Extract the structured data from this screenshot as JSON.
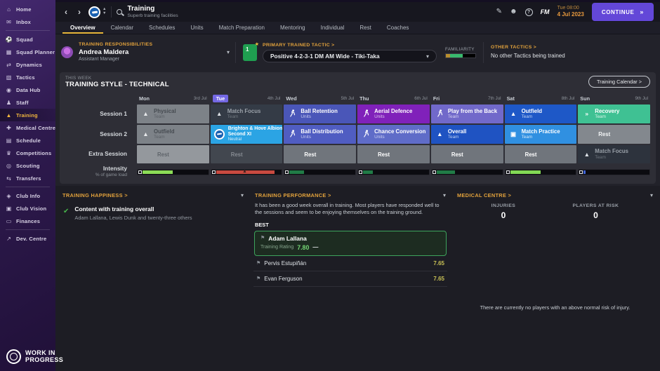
{
  "chrome": {
    "back": "‹",
    "forward": "›",
    "datetime": {
      "line1": "Tue 08:00",
      "line2": "4 Jul 2023"
    },
    "continue_label": "CONTINUE",
    "continue_arrows": "»",
    "fm_logo": "FM",
    "help_glyph": "?",
    "edit_glyph": "✎",
    "face_glyph": "☻"
  },
  "sidebar": {
    "active_index": 8,
    "items": [
      {
        "label": "Home",
        "icon": "home-icon",
        "glyph": "⌂"
      },
      {
        "label": "Inbox",
        "icon": "inbox-icon",
        "glyph": "✉",
        "divider_after": true
      },
      {
        "label": "Squad",
        "icon": "squad-icon",
        "glyph": "⚽"
      },
      {
        "label": "Squad Planner",
        "icon": "squad-planner-icon",
        "glyph": "▦"
      },
      {
        "label": "Dynamics",
        "icon": "dynamics-icon",
        "glyph": "⇄"
      },
      {
        "label": "Tactics",
        "icon": "tactics-icon",
        "glyph": "▧"
      },
      {
        "label": "Data Hub",
        "icon": "data-hub-icon",
        "glyph": "◉"
      },
      {
        "label": "Staff",
        "icon": "staff-icon",
        "glyph": "♟"
      },
      {
        "label": "Training",
        "icon": "training-icon",
        "glyph": "▲"
      },
      {
        "label": "Medical Centre",
        "icon": "medical-icon",
        "glyph": "✚"
      },
      {
        "label": "Schedule",
        "icon": "schedule-icon",
        "glyph": "▤"
      },
      {
        "label": "Competitions",
        "icon": "competitions-icon",
        "glyph": "♛"
      },
      {
        "label": "Scouting",
        "icon": "scouting-icon",
        "glyph": "◎"
      },
      {
        "label": "Transfers",
        "icon": "transfers-icon",
        "glyph": "⇆",
        "divider_after": true
      },
      {
        "label": "Club Info",
        "icon": "club-info-icon",
        "glyph": "◈"
      },
      {
        "label": "Club Vision",
        "icon": "club-vision-icon",
        "glyph": "▣"
      },
      {
        "label": "Finances",
        "icon": "finances-icon",
        "glyph": "▭",
        "divider_after": true
      },
      {
        "label": "Dev. Centre",
        "icon": "dev-centre-icon",
        "glyph": "↗"
      }
    ],
    "footer": {
      "line1": "WORK IN",
      "line2": "PROGRESS"
    }
  },
  "header": {
    "title": "Training",
    "subtitle": "Superb training facilities"
  },
  "tabs": {
    "active_index": 0,
    "items": [
      "Overview",
      "Calendar",
      "Schedules",
      "Units",
      "Match Preparation",
      "Mentoring",
      "Individual",
      "Rest",
      "Coaches"
    ]
  },
  "responsibilities": {
    "heading": "TRAINING RESPONSIBILITIES",
    "name": "Andrea Maldera",
    "role": "Assistant Manager"
  },
  "tactic": {
    "heading": "PRIMARY TRAINED TACTIC >",
    "value": "Positive 4-2-3-1 DM AM Wide - Tiki-Taka",
    "familiarity_label": "FAMILIARITY"
  },
  "other_tactics": {
    "heading": "OTHER TACTICS >",
    "text": "No other Tactics being trained"
  },
  "week": {
    "this_week_label": "THIS WEEK",
    "title": "TRAINING STYLE - TECHNICAL",
    "calendar_button": "Training Calendar >",
    "row_labels": {
      "session1": "Session 1",
      "session2": "Session 2",
      "extra": "Extra Session",
      "intensity": "Intensity",
      "intensity_sub": "% of game load"
    },
    "days": [
      {
        "name": "Mon",
        "date": "3rd Jul",
        "today": false,
        "session1": {
          "title": "Physical",
          "subtitle": "Team",
          "icon": "cone",
          "bg": "#7d8288",
          "fg": "#464b51",
          "sub": "#5a5f65",
          "ic": "#e6e8ea"
        },
        "session2": {
          "title": "Outfield",
          "subtitle": "Team",
          "icon": "cone",
          "bg": "#7d8288",
          "fg": "#464b51",
          "sub": "#5a5f65",
          "ic": "#e6e8ea"
        },
        "extra": {
          "type": "rest",
          "title": "Rest",
          "bg": "#94989d",
          "fg": "#5f646a"
        },
        "intensity": {
          "pct": 44,
          "color": "#8cdc57"
        }
      },
      {
        "name": "Tue",
        "date": "4th Jul",
        "today": true,
        "session1": {
          "title": "Match Focus",
          "subtitle": "Team",
          "icon": "cone",
          "bg": "#343b46",
          "fg": "#9aa1a9",
          "sub": "#717880",
          "ic": "#dde1e6"
        },
        "session2": {
          "type": "match",
          "title": "Brighton & Hove Albion",
          "title2": "Second XI",
          "subtitle": "Neutral",
          "bg": "#2ba4e4"
        },
        "extra": {
          "type": "rest",
          "title": "Rest",
          "bg": "#42474f",
          "fg": "#868b92"
        },
        "intensity": {
          "pct": 84,
          "color": "#c84a40",
          "warning": true
        }
      },
      {
        "name": "Wed",
        "date": "5th Jul",
        "today": false,
        "session1": {
          "title": "Ball Retention",
          "subtitle": "Units",
          "icon": "player",
          "bg": "#4a56b8",
          "fg": "#ffffff",
          "sub": "#c7ccf0",
          "ic": "#ffffff"
        },
        "session2": {
          "title": "Ball Distribution",
          "subtitle": "Units",
          "icon": "player",
          "bg": "#505dc2",
          "fg": "#ffffff",
          "sub": "#c7ccf0",
          "ic": "#ffffff"
        },
        "extra": {
          "type": "rest",
          "title": "Rest",
          "bg": "#70757c",
          "fg": "#ffffff"
        },
        "intensity": {
          "pct": 21,
          "color": "#217b46"
        }
      },
      {
        "name": "Thu",
        "date": "6th Jul",
        "today": false,
        "session1": {
          "title": "Aerial Defence",
          "subtitle": "Units",
          "icon": "player",
          "bg": "#8021ba",
          "fg": "#ffffff",
          "sub": "#dcc4ee",
          "ic": "#ffffff"
        },
        "session2": {
          "title": "Chance Conversion",
          "subtitle": "Units",
          "icon": "player",
          "bg": "#5f6cc8",
          "fg": "#ffffff",
          "sub": "#ccd1f2",
          "ic": "#ffffff"
        },
        "extra": {
          "type": "rest",
          "title": "Rest",
          "bg": "#70757c",
          "fg": "#ffffff"
        },
        "intensity": {
          "pct": 14,
          "color": "#217b46"
        }
      },
      {
        "name": "Fri",
        "date": "7th Jul",
        "today": false,
        "session1": {
          "title": "Play from the Back",
          "subtitle": "Team",
          "icon": "player",
          "bg": "#7169ca",
          "fg": "#ffffff",
          "sub": "#d4d0f0",
          "ic": "#ffffff"
        },
        "session2": {
          "title": "Overall",
          "subtitle": "Team",
          "icon": "cone",
          "bg": "#1f53c2",
          "fg": "#ffffff",
          "sub": "#bcd0f2",
          "ic": "#ffffff"
        },
        "extra": {
          "type": "rest",
          "title": "Rest",
          "bg": "#70757c",
          "fg": "#ffffff"
        },
        "intensity": {
          "pct": 27,
          "color": "#217b46"
        }
      },
      {
        "name": "Sat",
        "date": "8th Jul",
        "today": false,
        "session1": {
          "title": "Outfield",
          "subtitle": "Team",
          "icon": "cone",
          "bg": "#1e58c7",
          "fg": "#ffffff",
          "sub": "#bcd0f2",
          "ic": "#ffffff"
        },
        "session2": {
          "title": "Match Practice",
          "subtitle": "Team",
          "icon": "goal",
          "bg": "#3090e1",
          "fg": "#ffffff",
          "sub": "#d4e8f9",
          "ic": "#ffffff"
        },
        "extra": {
          "type": "rest",
          "title": "Rest",
          "bg": "#70757c",
          "fg": "#ffffff"
        },
        "intensity": {
          "pct": 44,
          "color": "#82d955"
        }
      },
      {
        "name": "Sun",
        "date": "9th Jul",
        "today": false,
        "session1": {
          "title": "Recovery",
          "subtitle": "Team",
          "icon": "recovery",
          "bg": "#3fc193",
          "fg": "#ffffff",
          "sub": "#dcf5ea",
          "ic": "#ffffff"
        },
        "session2": {
          "type": "rest",
          "title": "Rest",
          "bg": "#83888e",
          "fg": "#f2f4f5"
        },
        "extra": {
          "title": "Match Focus",
          "subtitle": "Team",
          "icon": "cone",
          "bg": "#2d333d",
          "fg": "#99a0a8",
          "sub": "#6d747d",
          "ic": "#dfe3e8"
        },
        "intensity": {
          "pct": 3,
          "color": "#3f64d4"
        }
      }
    ]
  },
  "happiness": {
    "heading": "TRAINING HAPPINESS >",
    "item": {
      "title": "Content with training overall",
      "subtitle": "Adam Lallana, Lewis Dunk and twenty-three others"
    }
  },
  "performance": {
    "heading": "TRAINING PERFORMANCE >",
    "summary": "It has been a good week overall in training. Most players have responded well to the sessions and seem to be enjoying themselves on the training ground.",
    "best_label": "BEST",
    "best": {
      "name": "Adam Lallana",
      "rating_label": "Training Rating",
      "rating": "7.80",
      "trend": "—"
    },
    "others": [
      {
        "name": "Pervis Estupiñán",
        "rating": "7.65"
      },
      {
        "name": "Evan Ferguson",
        "rating": "7.65"
      }
    ]
  },
  "medical": {
    "heading": "MEDICAL CENTRE >",
    "stats": [
      {
        "label": "INJURIES",
        "value": "0"
      },
      {
        "label": "PLAYERS AT RISK",
        "value": "0"
      }
    ],
    "note": "There are currently no players with an above normal risk of injury."
  },
  "colors": {
    "accent_orange": "#e2a23c",
    "accent_yellow": "#e8b73a",
    "continue_purple": "#6347d8",
    "today_purple": "#7468e4",
    "match_blue": "#2ba4e4"
  }
}
